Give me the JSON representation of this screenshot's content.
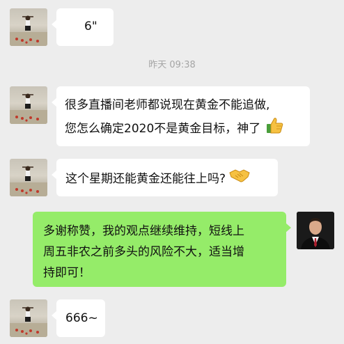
{
  "timestamp": "昨天 09:38",
  "messages": [
    {
      "sender": "contact",
      "text": "6\""
    },
    {
      "sender": "contact",
      "lines": [
        "很多直播间老师都说现在黄金不能追做,",
        "您怎么确定2020不是黄金目标，神了"
      ],
      "emoji": "thumbs-up"
    },
    {
      "sender": "contact",
      "text": "这个星期还能黄金还能往上吗?",
      "emoji": "handshake"
    },
    {
      "sender": "self",
      "lines": [
        "多谢称赞，我的观点继续维持，短线上",
        "周五非农之前多头的风险不大，适当增",
        "持即可！"
      ]
    },
    {
      "sender": "contact",
      "text": "666~"
    }
  ],
  "colors": {
    "background": "#ededed",
    "incoming_bubble": "#ffffff",
    "outgoing_bubble": "#95ec69",
    "timestamp_text": "#a5a5a5"
  }
}
